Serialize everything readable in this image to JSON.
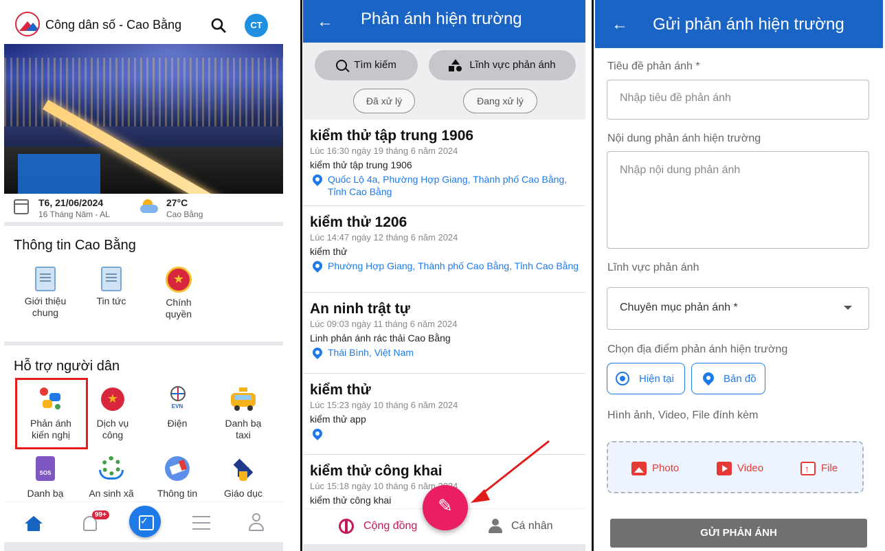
{
  "panel1": {
    "app_title": "Công dân số - Cao Bằng",
    "avatar_initials": "CT",
    "date": "T6, 21/06/2024",
    "lunar_date": "16 Tháng Năm - AL",
    "temperature": "27°C",
    "city": "Cao Bằng",
    "section_info_title": "Thông tin Cao Bằng",
    "info_tiles": [
      {
        "label": "Giới thiệu chung",
        "icon": "newspaper-icon"
      },
      {
        "label": "Tin tức",
        "icon": "newspaper-icon"
      },
      {
        "label": "Chính quyền",
        "icon": "national-emblem-icon"
      }
    ],
    "section_support_title": "Hỗ trợ người dân",
    "support_tiles": [
      {
        "label": "Phản ánh kiến nghị",
        "icon": "feedback-icon"
      },
      {
        "label": "Dịch vụ công",
        "icon": "public-service-icon"
      },
      {
        "label": "Điện",
        "icon": "evn-icon",
        "icon_text": "EVN"
      },
      {
        "label": "Danh bạ taxi",
        "icon": "taxi-icon"
      },
      {
        "label": "Danh bạ",
        "icon": "sos-directory-icon",
        "icon_text": "SOS"
      },
      {
        "label": "An sinh xã",
        "icon": "social-security-icon"
      },
      {
        "label": "Thông tin",
        "icon": "megaphone-icon"
      },
      {
        "label": "Giáo dục",
        "icon": "graduation-icon"
      }
    ],
    "nav": {
      "badge": "99+"
    }
  },
  "panel2": {
    "title": "Phản ánh hiện trường",
    "search_pill": "Tìm kiếm",
    "field_pill": "Lĩnh vực phản ánh",
    "status_filters": [
      "Đã xử lý",
      "Đang xử lý"
    ],
    "reports": [
      {
        "title": "kiểm thử tập trung 1906",
        "time": "Lúc 16:30 ngày 19 tháng 6 năm 2024",
        "content": "kiểm thử tập trung 1906",
        "location": "Quốc Lộ 4a, Phường Hợp Giang, Thành phố Cao Bằng, Tỉnh Cao Bằng"
      },
      {
        "title": "kiểm thử 1206",
        "time": "Lúc 14:47 ngày 12 tháng 6 năm 2024",
        "content": "kiểm thử",
        "location": "Phường Hợp Giang, Thành phố Cao Bằng, Tỉnh Cao Bằng"
      },
      {
        "title": "An ninh trật tự",
        "time": "Lúc 09:03 ngày 11 tháng 6 năm 2024",
        "content": "Linh phản ánh rác thải Cao Bằng",
        "location": "Thái Bình, Việt Nam"
      },
      {
        "title": "kiểm thử",
        "time": "Lúc 15:23 ngày 10 tháng 6 năm 2024",
        "content": "kiểm thử app",
        "location": ""
      },
      {
        "title": "kiểm thử công khai",
        "time": "Lúc 15:18 ngày 10 tháng 6 năm 2024",
        "content": "kiểm thử công khai",
        "location": ""
      }
    ],
    "tab_community": "Cộng đồng",
    "tab_personal": "Cá nhân"
  },
  "panel3": {
    "title": "Gửi phản ánh hiện trường",
    "title_label": "Tiêu đề phản ánh *",
    "title_placeholder": "Nhập tiêu đề phản ánh",
    "content_label": "Nội dung phản ánh hiện trường",
    "content_placeholder": "Nhập nội dung phản ánh",
    "field_label": "Lĩnh vực phản ánh",
    "field_select": "Chuyên mục phản ánh *",
    "location_label": "Chọn địa điểm phản ánh hiện trường",
    "btn_current": "Hiện tại",
    "btn_map": "Bản đồ",
    "attach_label": "Hình ảnh, Video, File đính kèm",
    "attach_photo": "Photo",
    "attach_video": "Video",
    "attach_file": "File",
    "submit": "GỬI PHẢN ÁNH"
  },
  "colors": {
    "primary_blue": "#1a64c5",
    "accent_pink": "#e91e63",
    "highlight_red": "#e21b1b"
  }
}
